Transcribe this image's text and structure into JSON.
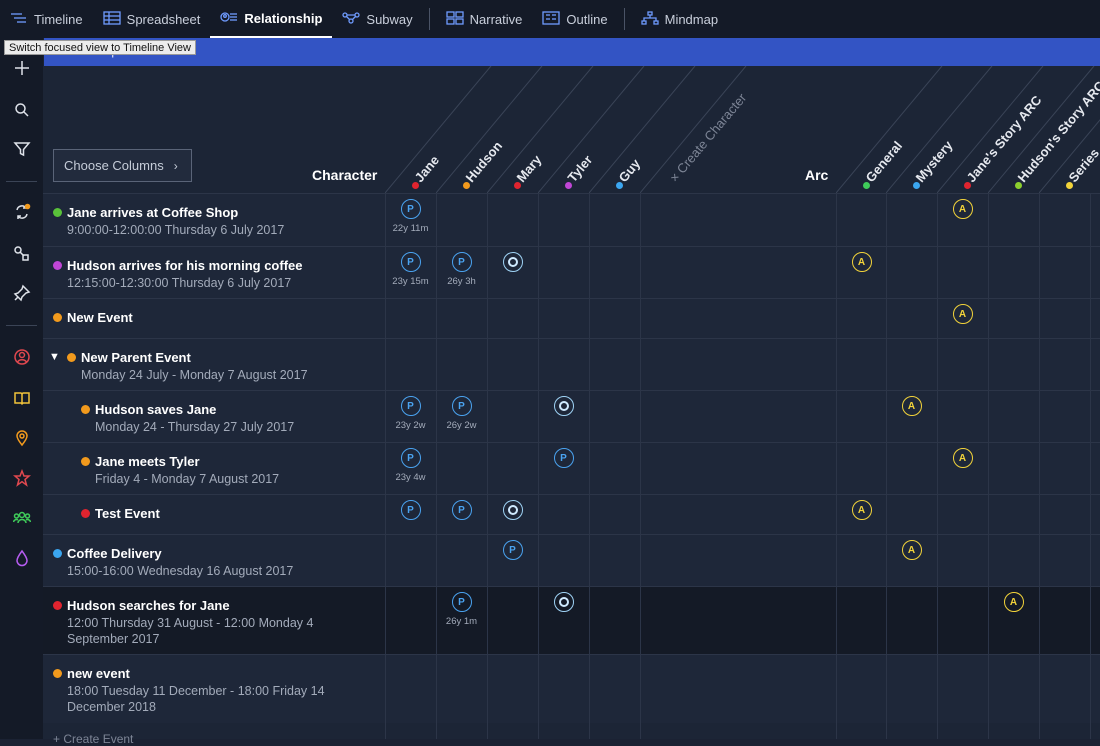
{
  "tabs": [
    {
      "label": "Timeline",
      "icon": "timeline-icon"
    },
    {
      "label": "Spreadsheet",
      "icon": "spreadsheet-icon"
    },
    {
      "label": "Relationship",
      "icon": "relationship-icon",
      "active": true
    },
    {
      "label": "Subway",
      "icon": "subway-icon"
    },
    {
      "label": "Narrative",
      "icon": "narrative-icon"
    },
    {
      "label": "Outline",
      "icon": "outline-icon"
    },
    {
      "label": "Mindmap",
      "icon": "mindmap-icon"
    }
  ],
  "tooltip": "Switch focused view to Timeline View",
  "banner": "Relationship",
  "sidebar": [
    "add-icon",
    "search-icon",
    "filter-icon",
    "sync-icon",
    "shapes-icon",
    "pin-icon",
    "character-icon",
    "book-icon",
    "location-icon",
    "star-icon",
    "group-icon",
    "drop-icon"
  ],
  "choose_columns": "Choose Columns",
  "sections": {
    "character": "Character",
    "arc": "Arc"
  },
  "columns": {
    "characters": [
      {
        "name": "Jane",
        "color": "#e0242f"
      },
      {
        "name": "Hudson",
        "color": "#f29a1d"
      },
      {
        "name": "Mary",
        "color": "#e0242f"
      },
      {
        "name": "Tyler",
        "color": "#c046d6"
      },
      {
        "name": "Guy",
        "color": "#3ba6f0"
      }
    ],
    "create_character": "Create Character",
    "arcs": [
      {
        "name": "General",
        "color": "#3fcc5a"
      },
      {
        "name": "Mystery",
        "color": "#3ba6f0"
      },
      {
        "name": "Jane's Story ARC",
        "color": "#e0242f"
      },
      {
        "name": "Hudson's Story ARC",
        "color": "#8ccf2e"
      },
      {
        "name": "Series",
        "color": "#f2d33a"
      }
    ]
  },
  "events": [
    {
      "title": "Jane arrives at Coffee Shop",
      "sub": [
        "9:00:00-12:00:00 Thursday 6 July 2017"
      ],
      "color": "#59c23a"
    },
    {
      "title": "Hudson arrives for his morning coffee",
      "sub": [
        "12:15:00-12:30:00 Thursday 6 July 2017"
      ],
      "color": "#c046d6"
    },
    {
      "title": "New Event",
      "sub": [],
      "color": "#f29a1d"
    },
    {
      "title": "New Parent Event",
      "sub": [
        "Monday 24 July - Monday 7 August 2017"
      ],
      "color": "#f29a1d",
      "caret": "▼"
    },
    {
      "title": "Hudson saves Jane",
      "sub": [
        "Monday 24 - Thursday 27 July 2017"
      ],
      "color": "#f29a1d"
    },
    {
      "title": "Jane meets Tyler",
      "sub": [
        "Friday 4 - Monday 7 August 2017"
      ],
      "color": "#f29a1d"
    },
    {
      "title": "Test Event",
      "sub": [],
      "color": "#e0242f"
    },
    {
      "title": "Coffee Delivery",
      "sub": [
        "15:00-16:00 Wednesday 16 August 2017"
      ],
      "color": "#3ba6f0"
    },
    {
      "title": "Hudson searches for Jane",
      "sub": [
        "12:00 Thursday 31 August - 12:00 Monday 4",
        "September 2017"
      ],
      "color": "#e0242f"
    },
    {
      "title": "new event",
      "sub": [
        "18:00 Tuesday 11 December - 18:00 Friday 14",
        "December 2018"
      ],
      "color": "#f29a1d"
    }
  ],
  "badges": [
    {
      "row": 0,
      "col": 0,
      "kind": "P",
      "age": "22y 11m"
    },
    {
      "row": 0,
      "col": 7,
      "kind": "A"
    },
    {
      "row": 1,
      "col": 0,
      "kind": "P",
      "age": "23y 15m"
    },
    {
      "row": 1,
      "col": 1,
      "kind": "P",
      "age": "26y 3h"
    },
    {
      "row": 1,
      "col": 2,
      "kind": "O"
    },
    {
      "row": 1,
      "col": 5,
      "kind": "A"
    },
    {
      "row": 2,
      "col": 7,
      "kind": "A"
    },
    {
      "row": 4,
      "col": 0,
      "kind": "P",
      "age": "23y 2w"
    },
    {
      "row": 4,
      "col": 1,
      "kind": "P",
      "age": "26y 2w"
    },
    {
      "row": 4,
      "col": 3,
      "kind": "O"
    },
    {
      "row": 4,
      "col": 6,
      "kind": "A"
    },
    {
      "row": 5,
      "col": 0,
      "kind": "P",
      "age": "23y 4w"
    },
    {
      "row": 5,
      "col": 3,
      "kind": "P"
    },
    {
      "row": 5,
      "col": 7,
      "kind": "A"
    },
    {
      "row": 6,
      "col": 0,
      "kind": "P"
    },
    {
      "row": 6,
      "col": 1,
      "kind": "P"
    },
    {
      "row": 6,
      "col": 2,
      "kind": "O"
    },
    {
      "row": 6,
      "col": 5,
      "kind": "A"
    },
    {
      "row": 7,
      "col": 2,
      "kind": "P"
    },
    {
      "row": 7,
      "col": 6,
      "kind": "A"
    },
    {
      "row": 8,
      "col": 1,
      "kind": "P",
      "age": "26y 1m"
    },
    {
      "row": 8,
      "col": 3,
      "kind": "O"
    },
    {
      "row": 8,
      "col": 8,
      "kind": "A"
    }
  ],
  "create_event": "+ Create Event"
}
